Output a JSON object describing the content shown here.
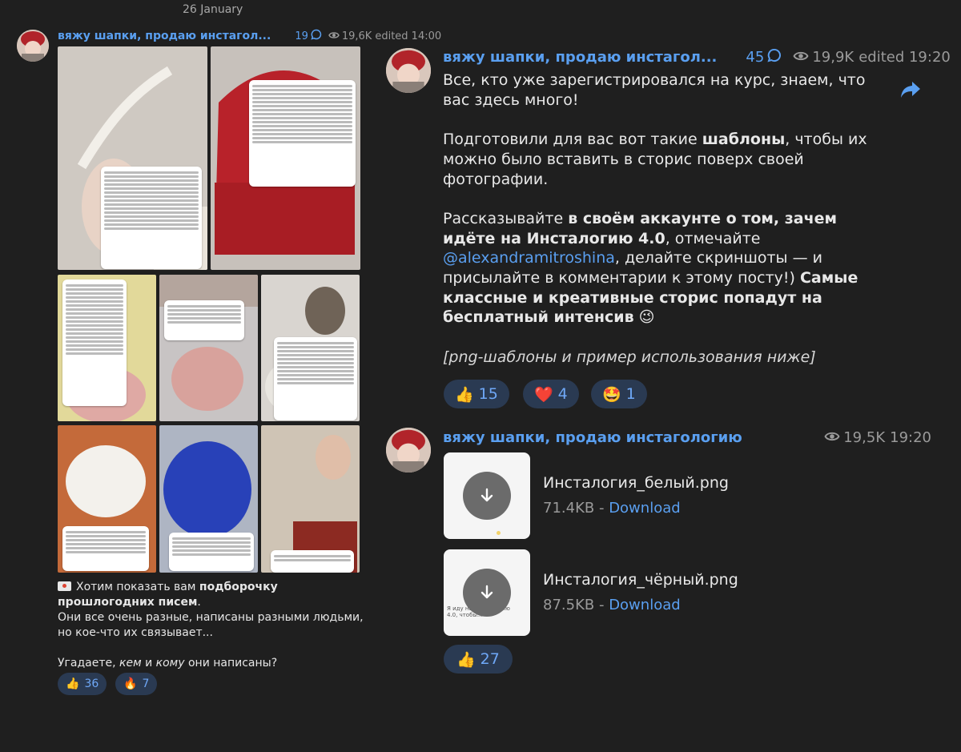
{
  "date_label": "26 January",
  "left_post": {
    "channel": "вяжу шапки, продаю инстагол...",
    "comments": "19",
    "views": "19,6K",
    "edited_time": "edited 14:00",
    "text_line1_prefix": "Хотим показать вам ",
    "text_line1_bold": "подборочку прошлогодних писем",
    "text_line1_suffix": ".",
    "text_line2": "Они все очень разные, написаны разными людьми, но кое-что их связывает...",
    "text_line3_prefix": "Угадаете, ",
    "text_line3_em1": "кем",
    "text_line3_mid": " и ",
    "text_line3_em2": "кому",
    "text_line3_suffix": " они написаны?",
    "reactions": [
      {
        "emoji": "👍",
        "count": "36"
      },
      {
        "emoji": "🔥",
        "count": "7"
      }
    ]
  },
  "right_post": {
    "channel": "вяжу шапки, продаю инстагол...",
    "comments": "45",
    "views": "19,9K",
    "edited_time": "edited 19:20",
    "p1": "Все, кто уже зарегистрировался на курс, знаем, что вас здесь много!",
    "p2_prefix": "Подготовили для вас вот такие ",
    "p2_bold": "шаблоны",
    "p2_suffix": ", чтобы их можно было вставить в сторис поверх своей фотографии.",
    "p3_prefix": "Рассказывайте ",
    "p3_bold": "в своём аккаунте о том, зачем идёте на Инсталогию 4.0",
    "p3_mid": ", отмечайте ",
    "p3_link": "@alexandramitroshina",
    "p3_mid2": ", делайте скриншоты — и присылайте в комментарии к этому посту!) ",
    "p3_bold2": "Самые классные и креативные сторис попадут на бесплатный интенсив",
    "p3_emoji": " 😉",
    "p4": "[png-шаблоны и пример использования ниже]",
    "reactions": [
      {
        "emoji": "👍",
        "count": "15"
      },
      {
        "emoji": "❤️",
        "count": "4"
      },
      {
        "emoji": "🤩",
        "count": "1"
      }
    ]
  },
  "file_post": {
    "channel": "вяжу шапки, продаю инстагологию",
    "views": "19,5K",
    "time": "19:20",
    "files": [
      {
        "name": "Инсталогия_белый.png",
        "size": "71.4KB",
        "sep": " - ",
        "action": "Download",
        "thumb_text": ""
      },
      {
        "name": "Инсталогия_чёрный.png",
        "size": "87.5KB",
        "sep": " - ",
        "action": "Download",
        "thumb_text": "Я иду на Инсталогию 4.0, чтобы..."
      }
    ],
    "reactions": [
      {
        "emoji": "👍",
        "count": "27"
      }
    ]
  },
  "colors": {
    "background": "#1f1f1f",
    "accent": "#5a9ff0",
    "reaction_bg": "#2a3a52",
    "meta": "#9a9a9a"
  }
}
